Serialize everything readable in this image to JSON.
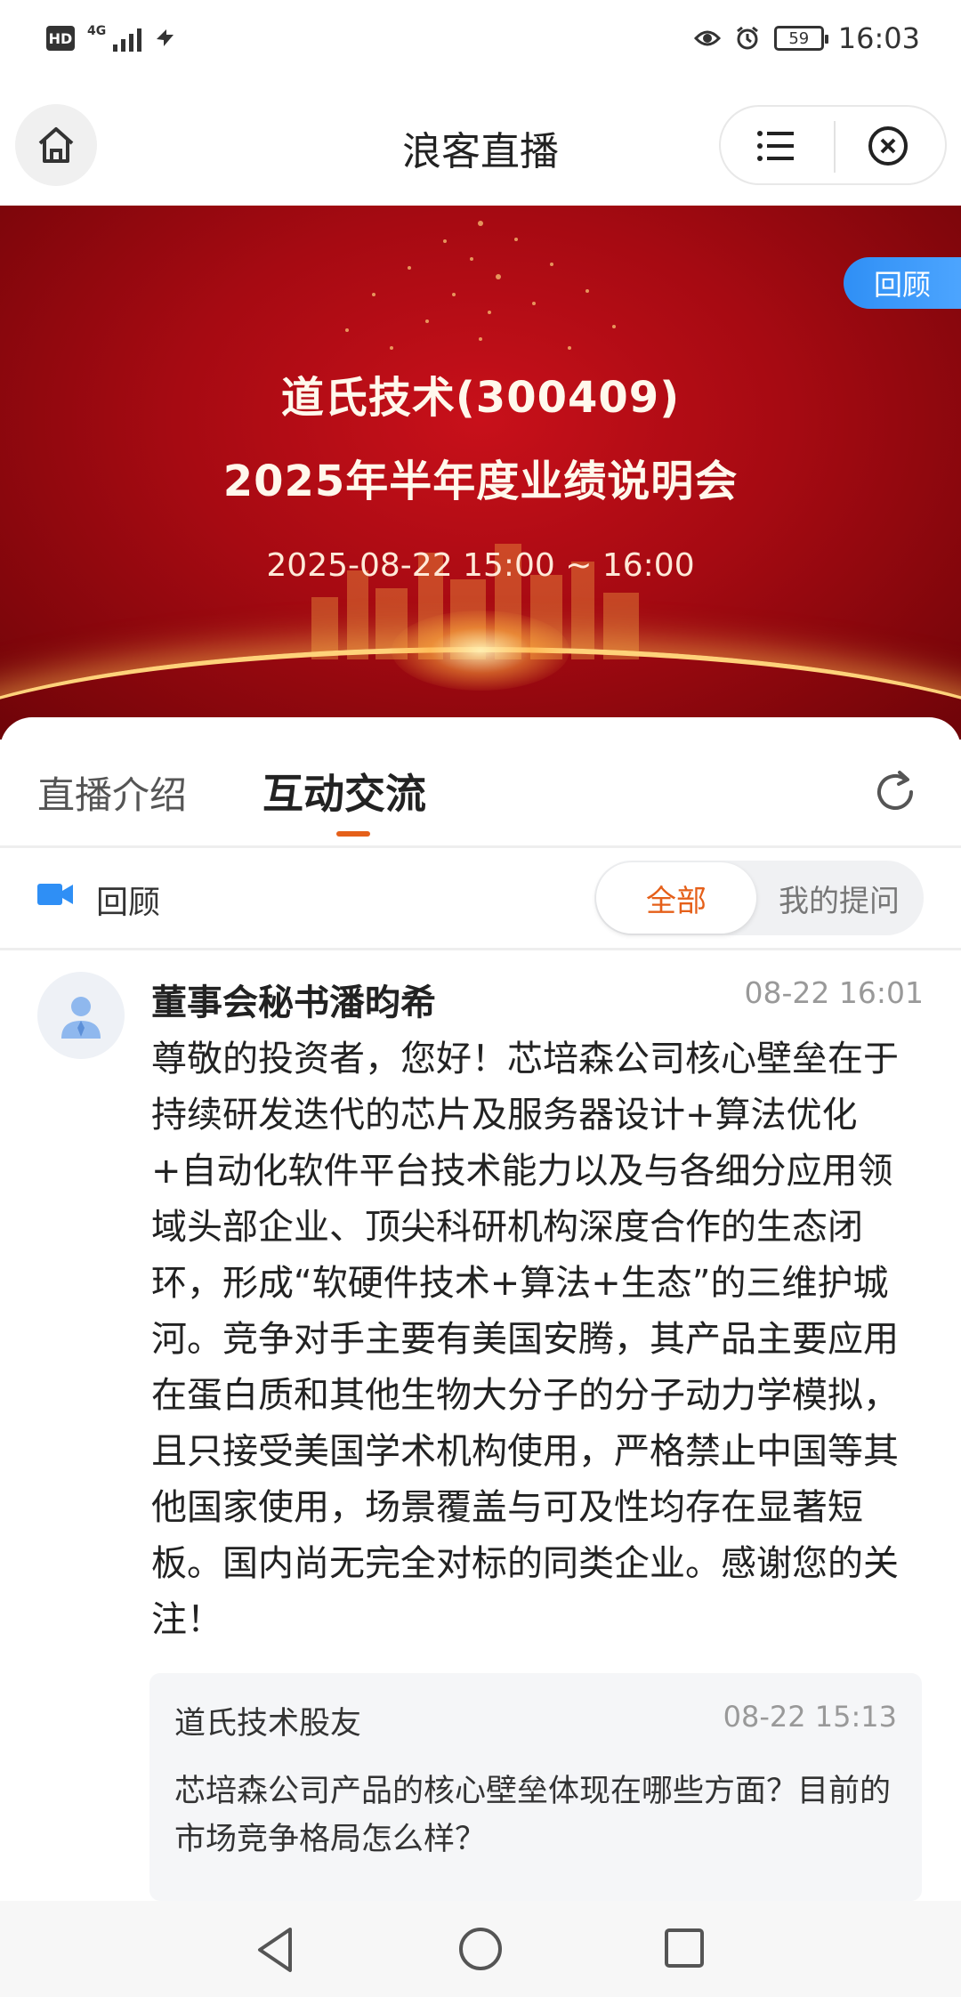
{
  "status_bar": {
    "left_badge": "HD",
    "network": "4G",
    "battery": "59",
    "time": "16:03",
    "icons": [
      "hd-icon",
      "signal-icon",
      "wifi-icon",
      "eye-icon",
      "alarm-icon",
      "battery-icon"
    ]
  },
  "nav": {
    "title": "浪客直播",
    "icons": [
      "home-icon",
      "menu-list-icon",
      "close-circle-icon"
    ]
  },
  "banner": {
    "line1": "道氏技术(300409)",
    "line2": "2025年半年度业绩说明会",
    "line3": "2025-08-22 15:00 ~ 16:00",
    "badge": "回顾",
    "colors": {
      "background": "#a60a12",
      "badge": "#2f8ff5",
      "text": "#fff8ec"
    }
  },
  "tabs": {
    "intro": "直播介绍",
    "chat": "互动交流",
    "active": "互动交流",
    "accent": "#e5601a",
    "icons": [
      "refresh-icon"
    ]
  },
  "filter": {
    "replay_label": "回顾",
    "segments": [
      "全部",
      "我的提问"
    ],
    "selected": "全部",
    "icons": [
      "video-icon"
    ]
  },
  "message": {
    "author": "董事会秘书潘昀希",
    "time": "08-22 16:01",
    "body": "尊敬的投资者，您好！芯培森公司核心壁垒在于持续研发迭代的芯片及服务器设计+算法优化+自动化软件平台技术能力以及与各细分应用领域头部企业、顶尖科研机构深度合作的生态闭环，形成“软硬件技术+算法+生态”的三维护城河。竞争对手主要有美国安腾，其产品主要应用在蛋白质和其他生物大分子的分子动力学模拟，且只接受美国学术机构使用，严格禁止中国等其他国家使用，场景覆盖与可及性均存在显著短板。国内尚无完全对标的同类企业。感谢您的关注！",
    "quote": {
      "author": "道氏技术股友",
      "time": "08-22 15:13",
      "text": "芯培森公司产品的核心壁垒体现在哪些方面？目前的市场竞争格局怎么样？"
    },
    "icons": [
      "avatar-icon"
    ]
  },
  "system_nav": {
    "icons": [
      "back-icon",
      "home-circle-icon",
      "recent-apps-icon"
    ]
  }
}
